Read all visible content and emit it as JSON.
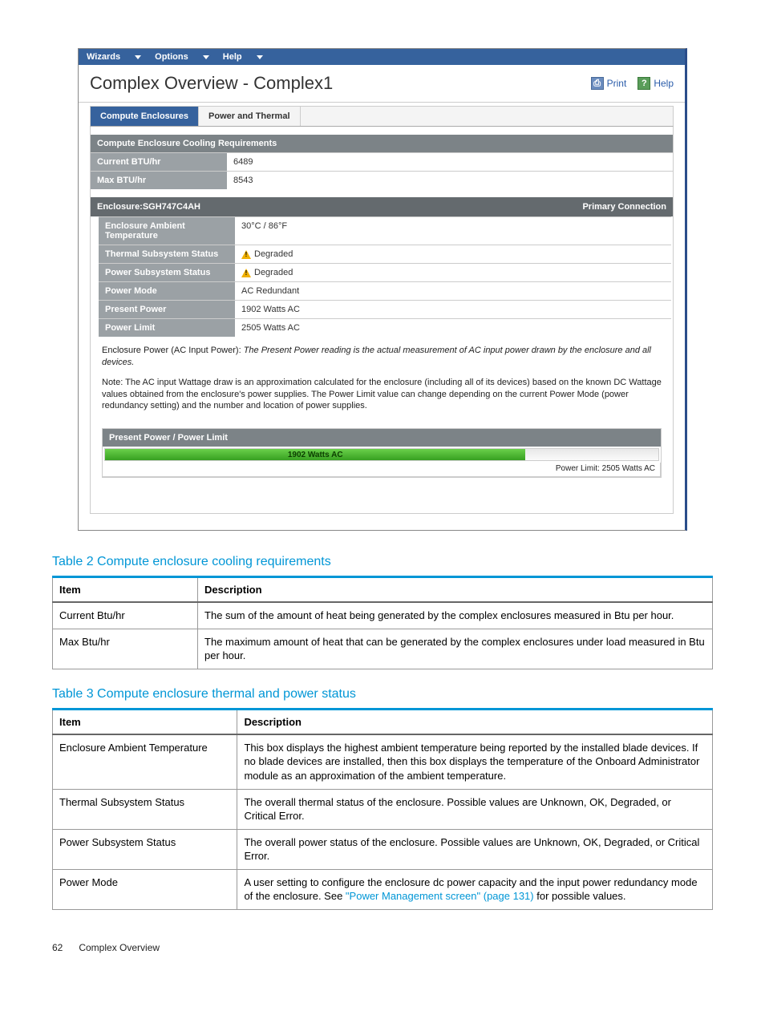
{
  "menubar": {
    "wizards": "Wizards",
    "options": "Options",
    "help": "Help"
  },
  "header": {
    "title": "Complex Overview - Complex1",
    "print_label": "Print",
    "help_label": "Help"
  },
  "tabs": {
    "compute": "Compute Enclosures",
    "power": "Power and Thermal"
  },
  "cooling": {
    "heading": "Compute Enclosure Cooling Requirements",
    "current_label": "Current BTU/hr",
    "current_val": "6489",
    "max_label": "Max BTU/hr",
    "max_val": "8543"
  },
  "enclosure": {
    "heading": "Enclosure:SGH747C4AH",
    "conn": "Primary Connection",
    "ambient_label": "Enclosure Ambient Temperature",
    "ambient_val": "30°C / 86°F",
    "thermal_label": "Thermal Subsystem Status",
    "thermal_val": "Degraded",
    "power_sub_label": "Power Subsystem Status",
    "power_sub_val": "Degraded",
    "mode_label": "Power Mode",
    "mode_val": "AC Redundant",
    "present_label": "Present Power",
    "present_val": "1902 Watts AC",
    "limit_label": "Power Limit",
    "limit_val": "2505 Watts AC"
  },
  "notes": {
    "p1a": "Enclosure Power  (AC Input Power): ",
    "p1b": "The Present Power reading is the actual measurement of AC input power drawn by the enclosure and all devices.",
    "p2": "Note: The AC input Wattage draw is an approximation calculated for the enclosure (including all of its devices) based on the known DC Wattage values obtained from the enclosure's power supplies.  The Power Limit value can change depending on the current Power Mode (power redundancy setting) and the number and location of power supplies."
  },
  "ppbar": {
    "heading": "Present Power / Power Limit",
    "bar_label": "1902 Watts AC",
    "right_label": "Power Limit: 2505 Watts AC"
  },
  "table2": {
    "title": "Table 2 Compute enclosure cooling requirements",
    "h1": "Item",
    "h2": "Description",
    "rows": [
      {
        "item": "Current Btu/hr",
        "desc": "The sum of the amount of heat being generated by the complex enclosures measured in Btu per hour."
      },
      {
        "item": "Max Btu/hr",
        "desc": "The maximum amount of heat that can be generated by the complex enclosures under load measured in Btu per hour."
      }
    ]
  },
  "table3": {
    "title": "Table 3 Compute enclosure thermal and power status",
    "h1": "Item",
    "h2": "Description",
    "rows": [
      {
        "item": "Enclosure Ambient Temperature",
        "desc": "This box displays the highest ambient temperature being reported by the installed blade devices. If no blade devices are installed, then this box displays the temperature of the Onboard Administrator module as an approximation of the ambient temperature."
      },
      {
        "item": "Thermal Subsystem Status",
        "desc": "The overall thermal status of the enclosure. Possible values are Unknown, OK, Degraded, or Critical Error."
      },
      {
        "item": "Power Subsystem Status",
        "desc": "The overall power status of the enclosure. Possible values are Unknown, OK, Degraded, or Critical Error."
      },
      {
        "item": "Power Mode",
        "desc_pre": "A user setting to configure the enclosure dc power capacity and the input power redundancy mode of the enclosure. See ",
        "link": "\"Power Management screen\" (page 131)",
        "desc_post": " for possible values."
      }
    ]
  },
  "footer": {
    "page": "62",
    "section": "Complex Overview"
  },
  "chart_data": {
    "type": "bar",
    "title": "Present Power / Power Limit",
    "categories": [
      "Present Power"
    ],
    "values": [
      1902
    ],
    "ylim": [
      0,
      2505
    ],
    "xlabel": "",
    "ylabel": "Watts AC",
    "annotations": {
      "power_limit": 2505
    }
  }
}
